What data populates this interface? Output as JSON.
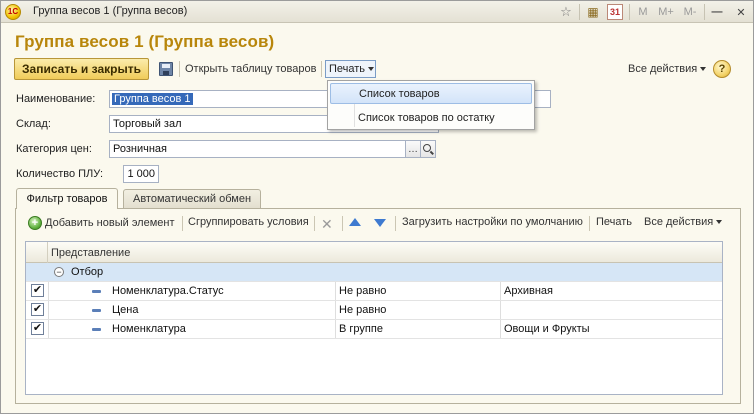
{
  "window": {
    "app_icon": "1c-logo-icon",
    "app_icon_text": "1С",
    "title": "Группа весов 1 (Группа весов)",
    "toolbar_buttons": [
      {
        "name": "favorites-icon",
        "glyph": "☆"
      },
      {
        "name": "calculator-icon",
        "glyph": "▦"
      },
      {
        "name": "calendar-icon",
        "glyph": "31"
      },
      {
        "name": "memory-m-button",
        "glyph": "M"
      },
      {
        "name": "memory-m-plus-button",
        "glyph": "M+"
      },
      {
        "name": "memory-m-minus-button",
        "glyph": "M-"
      },
      {
        "name": "minimize-icon",
        "glyph": "—"
      },
      {
        "name": "close-icon",
        "glyph": "✕"
      }
    ]
  },
  "form": {
    "title": "Группа весов 1 (Группа весов)"
  },
  "commandbar": {
    "save_close": "Записать и закрыть",
    "open_table": "Открыть таблицу товаров",
    "print": "Печать",
    "all_actions": "Все действия",
    "help": "?"
  },
  "print_menu": {
    "items": [
      "Список товаров",
      "Список товаров по остатку"
    ]
  },
  "fields": {
    "name_label": "Наименование:",
    "name_value": "Группа весов 1",
    "warehouse_label": "Склад:",
    "warehouse_value": "Торговый зал",
    "price_category_label": "Категория цен:",
    "price_category_value": "Розничная",
    "ppu_label": "Количество ПЛУ:",
    "ppu_value": "1 000"
  },
  "tabs": [
    "Фильтр товаров",
    "Автоматический обмен"
  ],
  "panel_toolbar": {
    "add": "Добавить новый элемент",
    "group": "Сгруппировать условия",
    "load_defaults": "Загрузить настройки по умолчанию",
    "print": "Печать",
    "all_actions": "Все действия"
  },
  "grid": {
    "header": "Представление",
    "group_row": "Отбор",
    "rows": [
      {
        "checked": true,
        "field": "Номенклатура.Статус",
        "condition": "Не равно",
        "value": "Архивная"
      },
      {
        "checked": true,
        "field": "Цена",
        "condition": "Не равно",
        "value": ""
      },
      {
        "checked": true,
        "field": "Номенклатура",
        "condition": "В группе",
        "value": "Овощи и Фрукты"
      }
    ]
  }
}
